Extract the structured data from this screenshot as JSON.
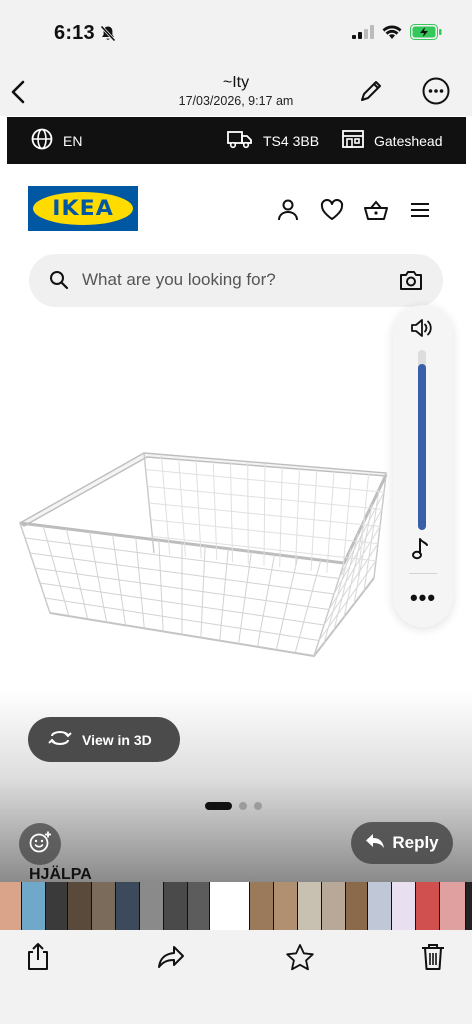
{
  "status_bar": {
    "time": "6:13",
    "battery_color": "#34c759"
  },
  "photo_header": {
    "title": "~Ity",
    "subtitle": "17/03/2026, 9:17 am"
  },
  "ikea_topbar": {
    "language": "EN",
    "postcode": "TS4 3BB",
    "store": "Gateshead"
  },
  "logo": {
    "text": "IKEA",
    "brand_blue": "#0058a3",
    "brand_yellow": "#ffdb00"
  },
  "search": {
    "placeholder": "What are you looking for?"
  },
  "volume": {
    "level_fraction": 0.92,
    "accent": "#3b5ea8"
  },
  "product": {
    "view3d_label": "View in 3D",
    "image_count": 3,
    "current_image": 1
  },
  "reply_label": "Reply",
  "caption": "HJÄLPA",
  "thumbnails": [
    "#d9a48a",
    "#6fa8c9",
    "#3a3a3a",
    "#5a4a3c",
    "#7a6b5a",
    "#3c4a5c",
    "#8a8a8a",
    "#4a4a4a",
    "#5c5c5c",
    "#ffffff",
    "#9a7a5a",
    "#b09070",
    "#c8c0b0",
    "#b8a898",
    "#8a6a4a",
    "#c0c8d8",
    "#e8e0f0",
    "#d05050",
    "#e0a0a0"
  ]
}
